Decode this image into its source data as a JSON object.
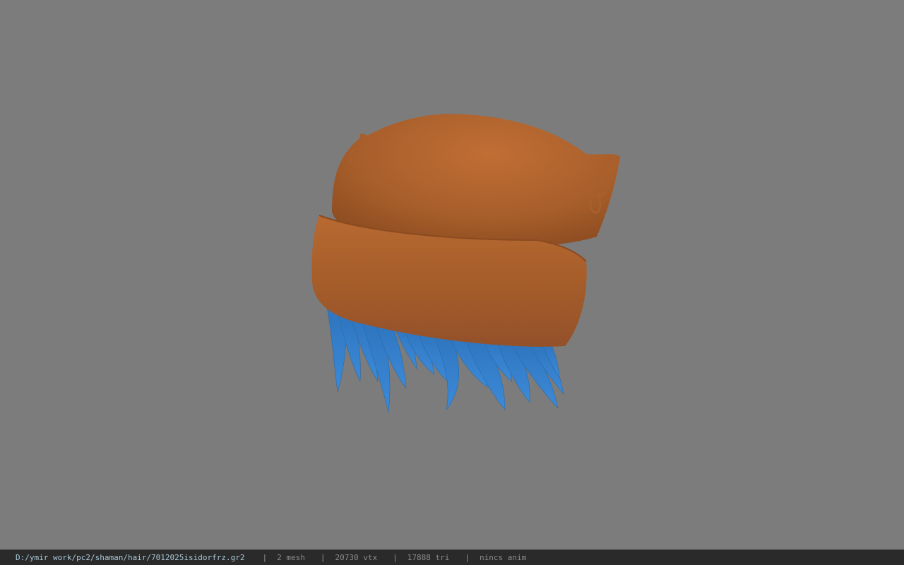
{
  "viewport": {
    "background": "#7c7c7c",
    "model": {
      "hat_color": "#b0652f",
      "hat_shadow": "#8f4f24",
      "hair_color": "#3a86d4",
      "hair_shadow": "#2a6bb0"
    }
  },
  "statusbar": {
    "file_path": "D:/ymir work/pc2/shaman/hair/7012025isidorfrz.gr2",
    "separator": "|",
    "mesh_count": "2 mesh",
    "vertex_count": "20730 vtx",
    "triangle_count": "17888 tri",
    "anim_status": "nincs anim"
  }
}
